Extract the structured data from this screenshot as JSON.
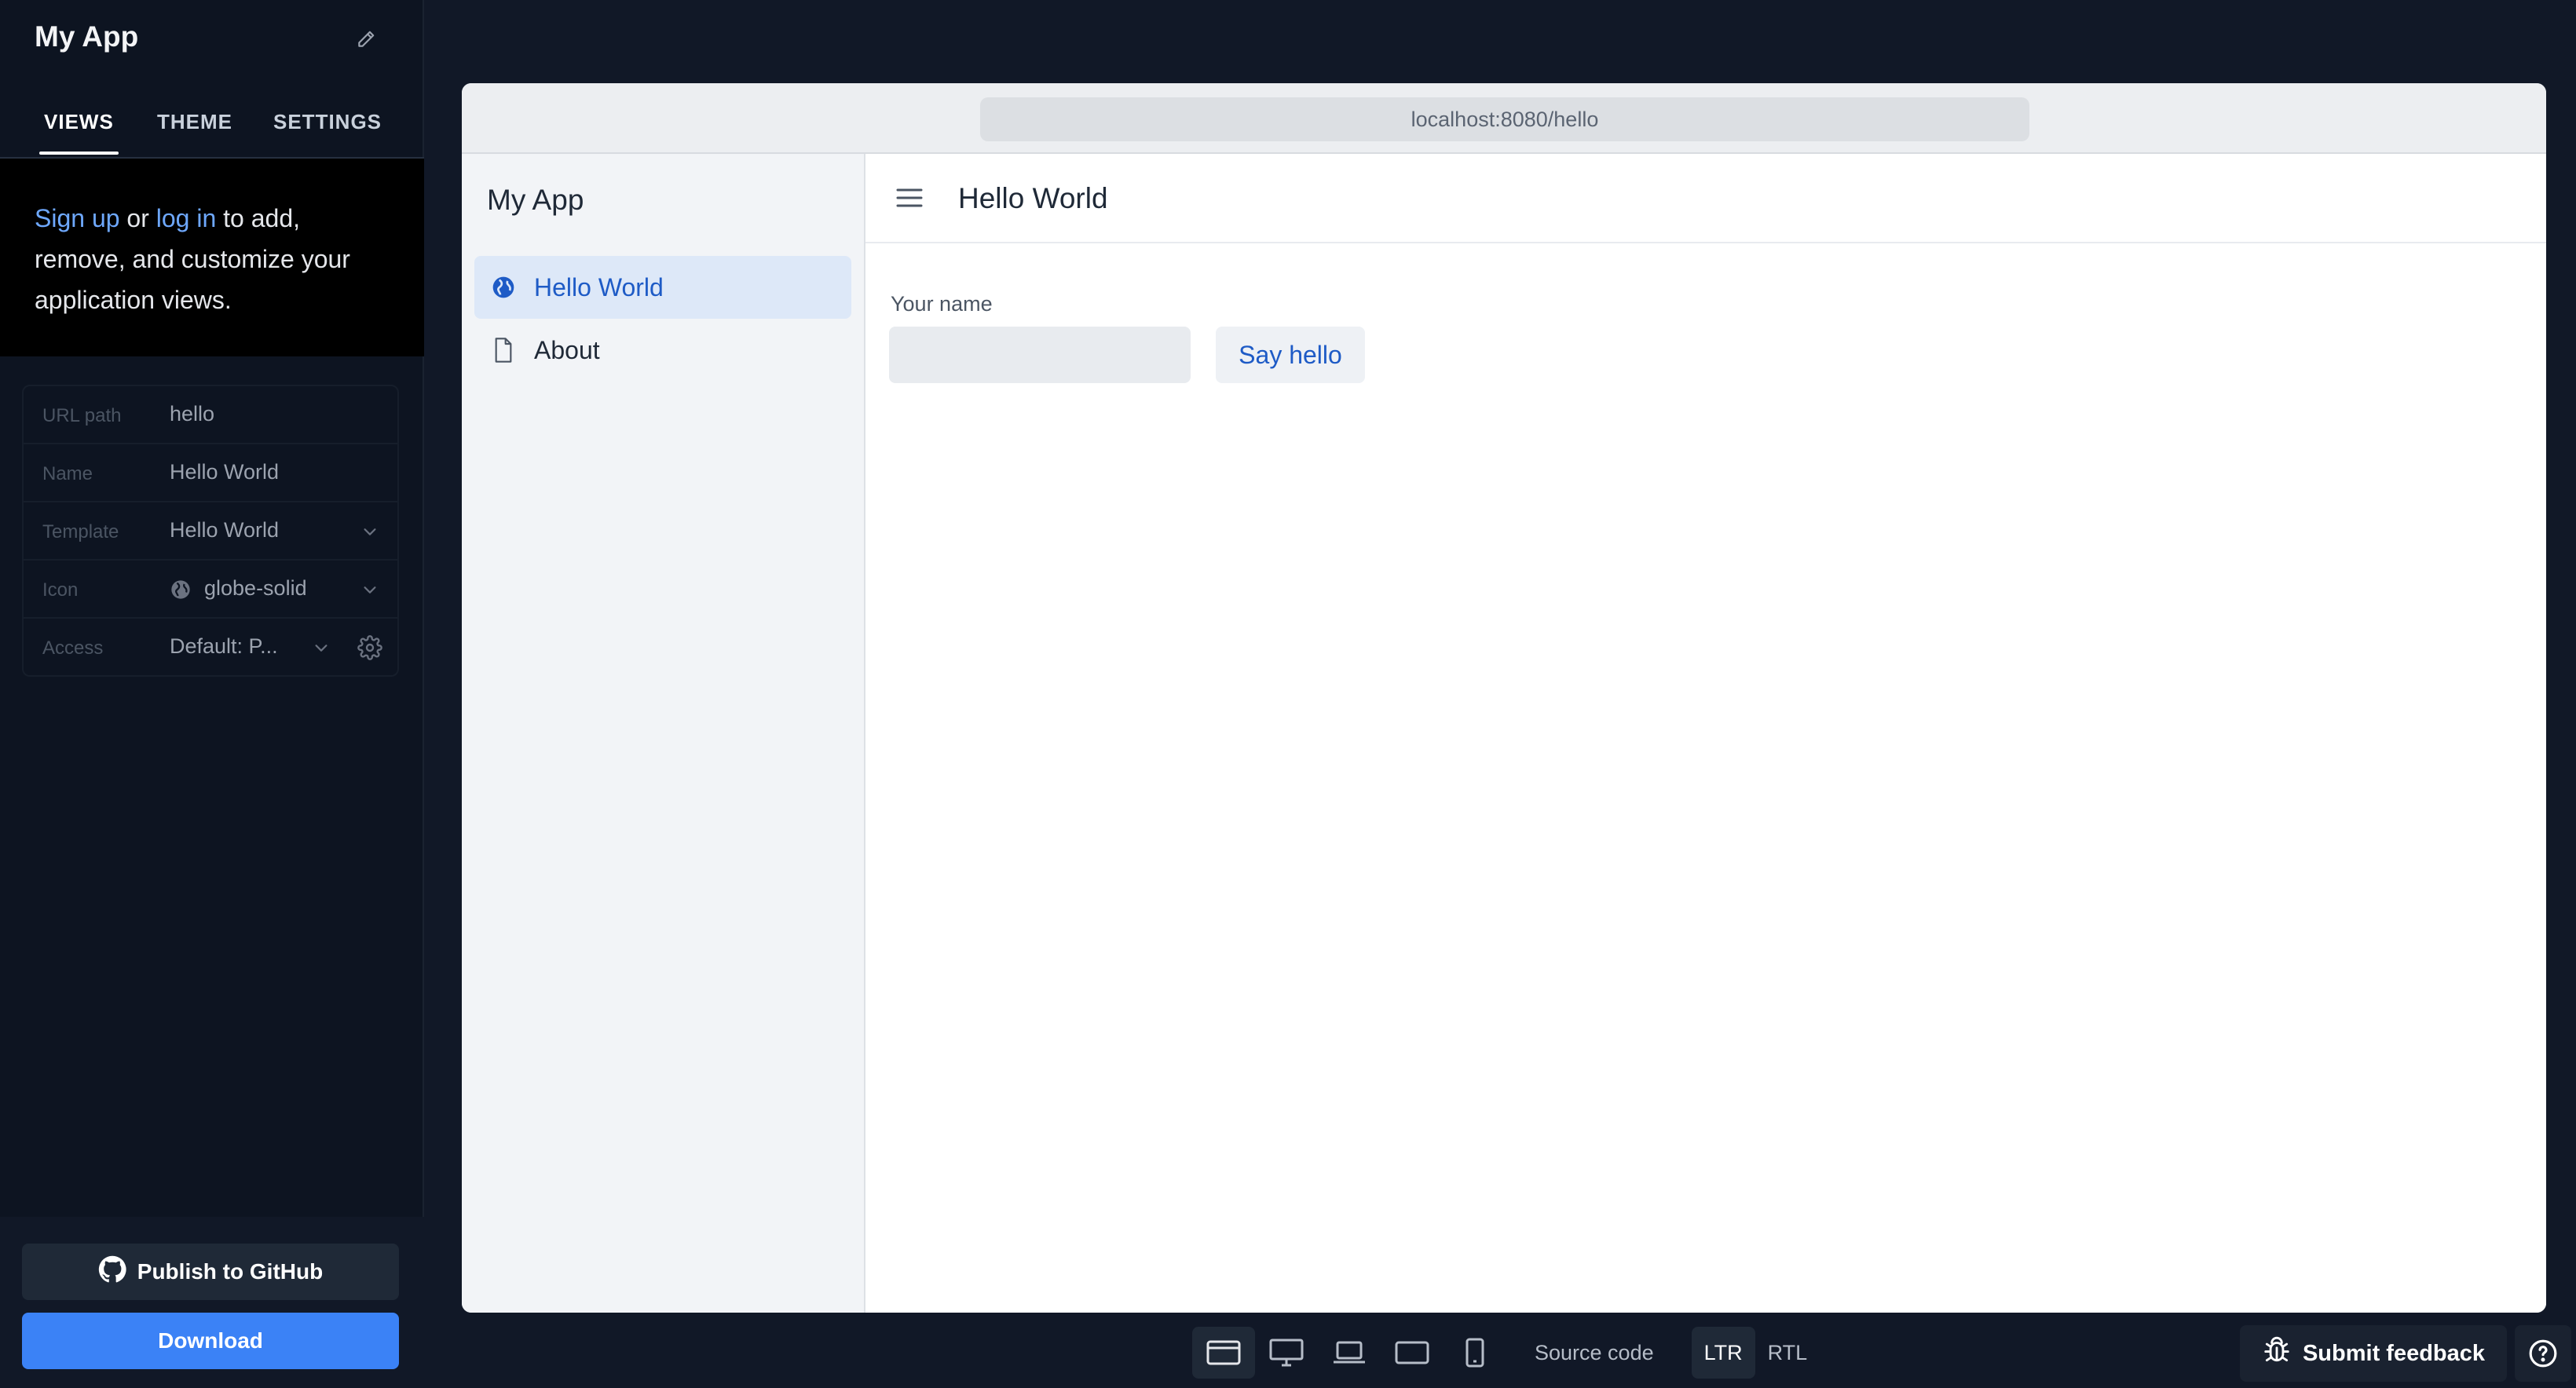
{
  "editor": {
    "app_title": "My App",
    "tabs": [
      {
        "label": "VIEWS",
        "active": true
      },
      {
        "label": "THEME",
        "active": false
      },
      {
        "label": "SETTINGS",
        "active": false
      }
    ],
    "notice": {
      "signup": "Sign up",
      "or": " or ",
      "login": "log in",
      "rest": " to add, remove, and customize your application views."
    },
    "properties": {
      "url_path": {
        "label": "URL path",
        "value": "hello"
      },
      "name": {
        "label": "Name",
        "value": "Hello World"
      },
      "template": {
        "label": "Template",
        "value": "Hello World"
      },
      "icon": {
        "label": "Icon",
        "value": "globe-solid",
        "icon": "globe-icon"
      },
      "access": {
        "label": "Access",
        "value": "Default: P..."
      }
    },
    "footer": {
      "publish_label": "Publish to GitHub",
      "download_label": "Download"
    }
  },
  "preview": {
    "url": "localhost:8080/hello",
    "app_title": "My App",
    "nav": [
      {
        "label": "Hello World",
        "icon": "globe-icon",
        "active": true
      },
      {
        "label": "About",
        "icon": "file-icon",
        "active": false
      }
    ],
    "view_title": "Hello World",
    "form": {
      "label": "Your name",
      "value": "",
      "button_label": "Say hello"
    }
  },
  "toolbar": {
    "source_code": "Source code",
    "ltr": "LTR",
    "rtl": "RTL",
    "feedback_label": "Submit feedback"
  },
  "colors": {
    "accent": "#3b82f6",
    "link": "#6ea8fe",
    "nav_active_bg": "#dde8f8",
    "nav_active_text": "#1e5bc6"
  }
}
